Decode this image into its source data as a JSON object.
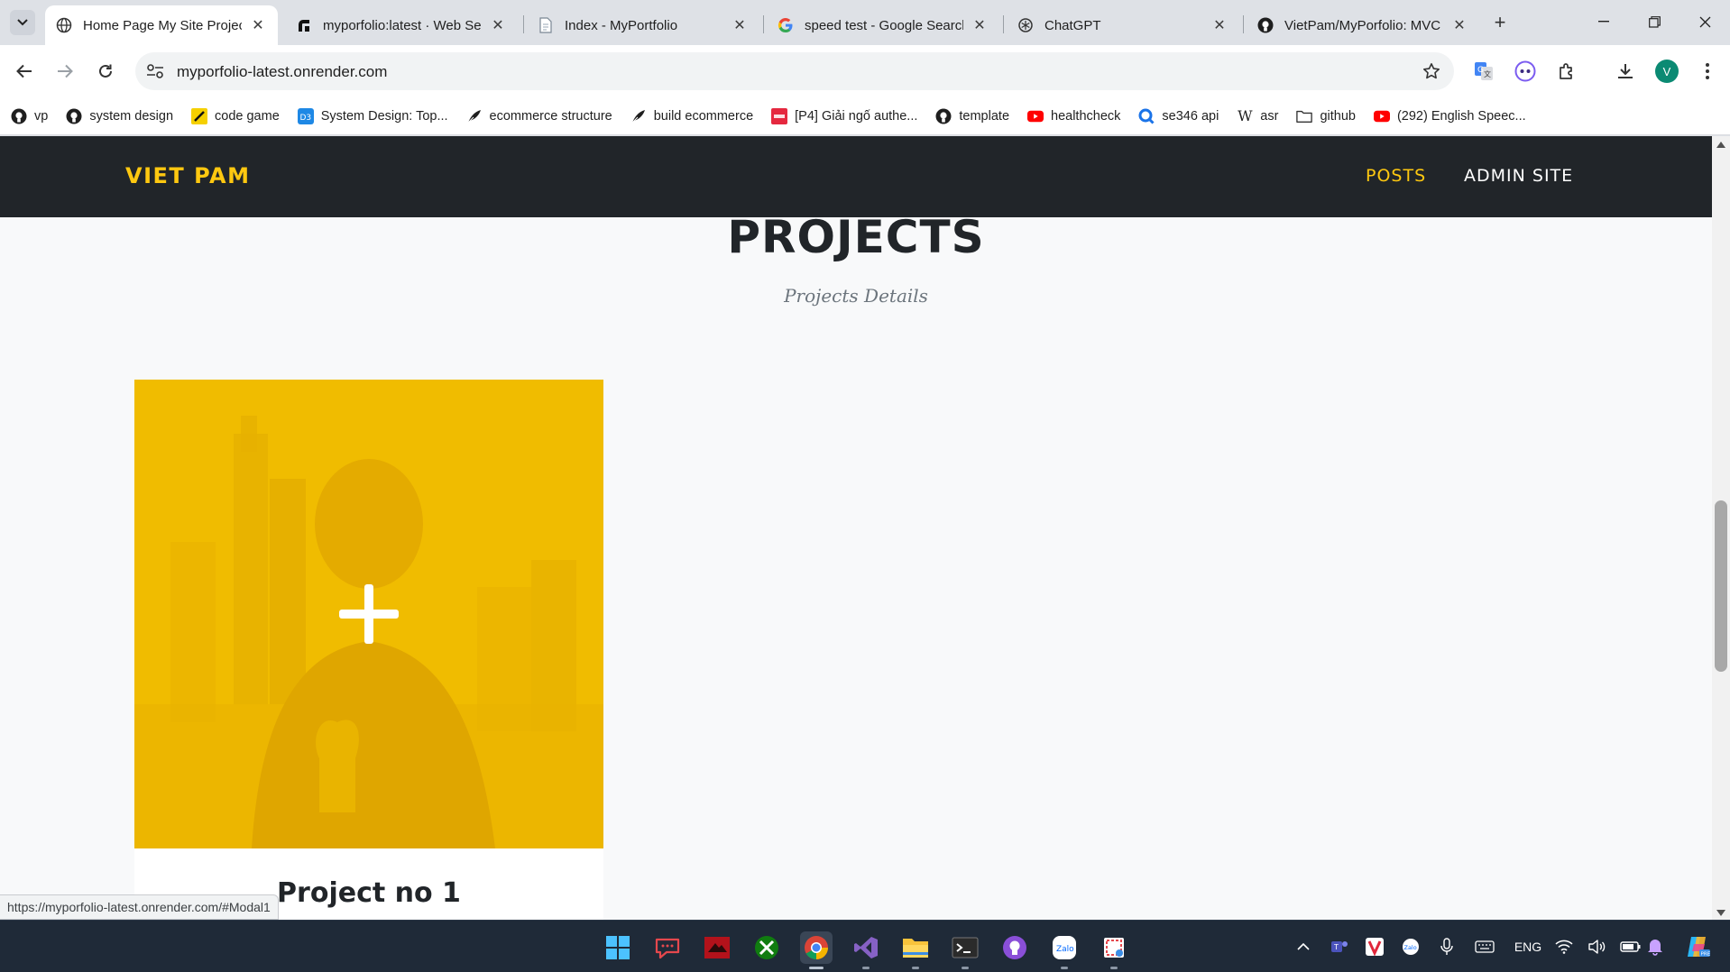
{
  "browser": {
    "tabs": [
      {
        "title": "Home Page My Site Projec",
        "icon": "globe-icon",
        "active": true
      },
      {
        "title": "myporfolio:latest · Web Se",
        "icon": "render-icon",
        "active": false
      },
      {
        "title": "Index - MyPortfolio",
        "icon": "document-icon",
        "active": false
      },
      {
        "title": "speed test - Google Search",
        "icon": "google-icon",
        "active": false
      },
      {
        "title": "ChatGPT",
        "icon": "chatgpt-icon",
        "active": false
      },
      {
        "title": "VietPam/MyPorfolio: MVC",
        "icon": "github-icon",
        "active": false
      }
    ],
    "url": "myporfolio-latest.onrender.com",
    "profile_initial": "V",
    "bookmarks": [
      {
        "label": "vp",
        "icon": "github-icon"
      },
      {
        "label": "system design",
        "icon": "github-icon"
      },
      {
        "label": "code game",
        "icon": "codegame-icon"
      },
      {
        "label": "System Design: Top...",
        "icon": "d3-icon"
      },
      {
        "label": "ecommerce structure",
        "icon": "quill-icon"
      },
      {
        "label": "build ecommerce",
        "icon": "quill-icon"
      },
      {
        "label": "[P4] Giải ngố authe...",
        "icon": "viblo-icon"
      },
      {
        "label": "template",
        "icon": "github-icon"
      },
      {
        "label": "healthcheck",
        "icon": "youtube-icon"
      },
      {
        "label": "se346 api",
        "icon": "postman-icon"
      },
      {
        "label": "asr",
        "icon": "wikipedia-icon"
      },
      {
        "label": "github",
        "icon": "folder-icon"
      },
      {
        "label": "(292) English Speec...",
        "icon": "youtube-icon"
      }
    ],
    "status_url": "https://myporfolio-latest.onrender.com/#Modal1"
  },
  "site": {
    "brand": "VIET PAM",
    "nav": [
      {
        "label": "POSTS",
        "active": true
      },
      {
        "label": "ADMIN SITE",
        "active": false
      }
    ],
    "section": {
      "heading": "PROJECTS",
      "subheading": "Projects Details"
    },
    "projects": [
      {
        "title": "Project no 1",
        "overlay_color": "#fec810"
      }
    ]
  },
  "taskbar": {
    "apps": [
      "start-icon",
      "chat-icon",
      "game-icon",
      "xbox-icon",
      "chrome-icon",
      "visual-studio-icon",
      "file-explorer-icon",
      "terminal-icon",
      "github-desktop-icon",
      "zalo-icon",
      "snipping-tool-icon"
    ],
    "language": "ENG"
  },
  "colors": {
    "accent": "#fec810",
    "nav_bg": "#212529",
    "page_bg": "#f8f9fa"
  }
}
